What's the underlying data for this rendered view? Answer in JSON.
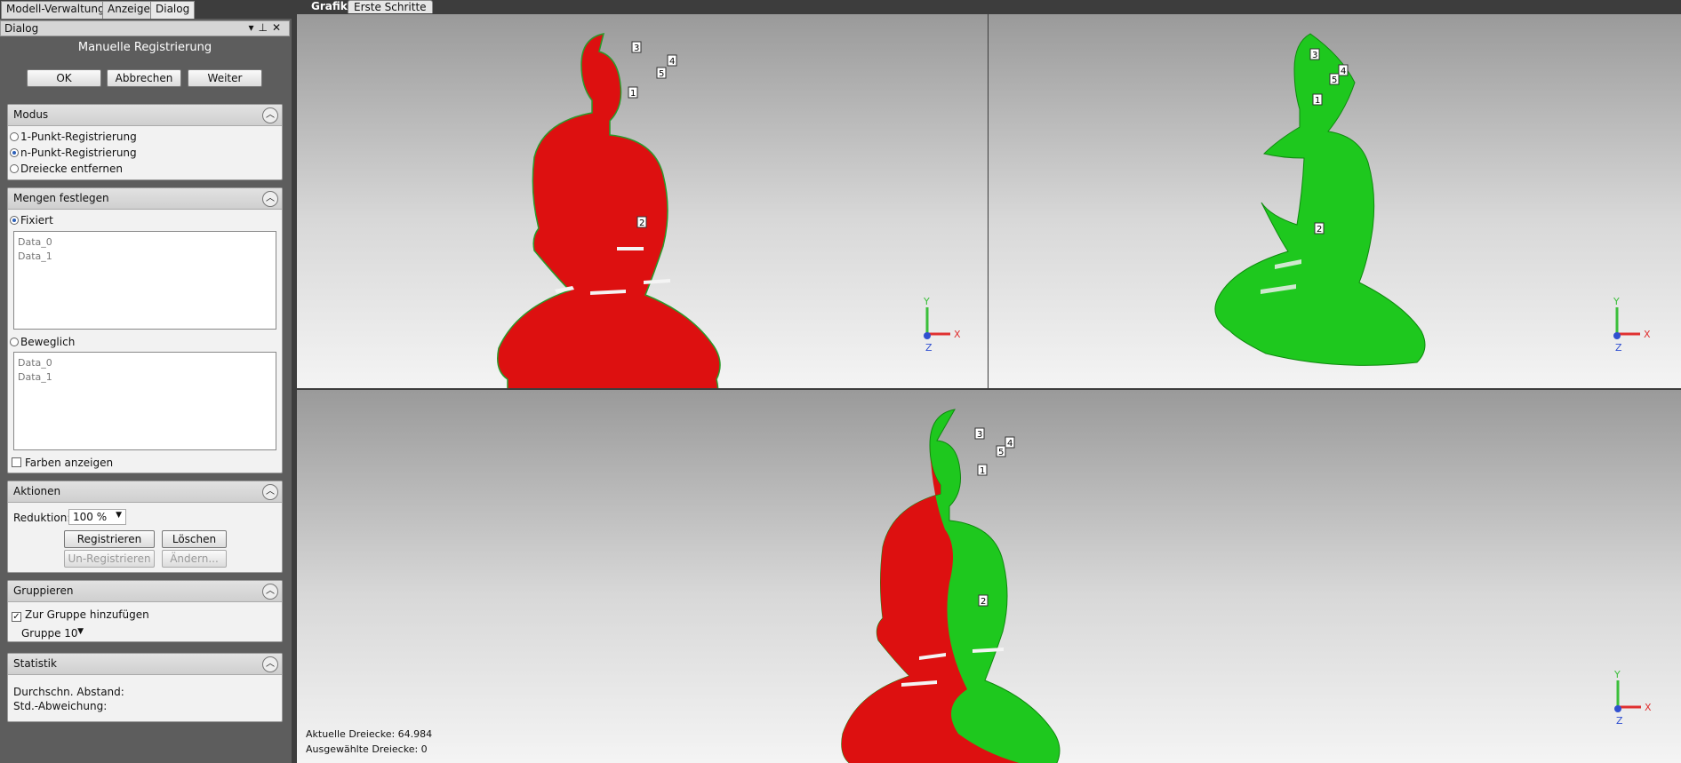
{
  "left_tabs": [
    "Modell-Verwaltung",
    "Anzeige",
    "Dialog"
  ],
  "dialog": {
    "header": "Dialog",
    "title": "Manuelle Registrierung",
    "ok": "OK",
    "cancel": "Abbrechen",
    "next": "Weiter"
  },
  "modus": {
    "title": "Modus",
    "options": [
      "1-Punkt-Registrierung",
      "n-Punkt-Registrierung",
      "Dreiecke entfernen"
    ],
    "selected_index": 1
  },
  "mengen": {
    "title": "Mengen festlegen",
    "fixed_label": "Fixiert",
    "fixed_items": [
      "Data_0",
      "Data_1"
    ],
    "movable_label": "Beweglich",
    "movable_items": [
      "Data_0",
      "Data_1"
    ],
    "show_colors": "Farben anzeigen"
  },
  "aktionen": {
    "title": "Aktionen",
    "reduction_label": "Reduktion:",
    "reduction_value": "100 %",
    "register": "Registrieren",
    "delete": "Löschen",
    "unregister": "Un-Registrieren",
    "change": "Ändern..."
  },
  "gruppieren": {
    "title": "Gruppieren",
    "add_to_group": "Zur Gruppe hinzufügen",
    "group_value": "Gruppe 10"
  },
  "statistik": {
    "title": "Statistik",
    "avg_distance": "Durchschn. Abstand:",
    "std_dev": "Std.-Abweichung:"
  },
  "right_tabs": [
    "Grafik",
    "Erste Schritte"
  ],
  "status": {
    "current_triangles": "Aktuelle Dreiecke: 64.984",
    "selected_triangles": "Ausgewählte Dreiecke: 0"
  },
  "markers": [
    "1",
    "2",
    "3",
    "4",
    "5"
  ],
  "axes": {
    "x": "X",
    "y": "Y",
    "z": "Z"
  },
  "colors": {
    "fixed_model": "#dd1010",
    "movable_model": "#1ec81e",
    "axis_x": "#e03030",
    "axis_y": "#3bbf3b",
    "axis_z": "#3050d0"
  }
}
